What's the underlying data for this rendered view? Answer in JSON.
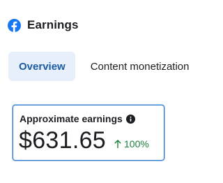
{
  "header": {
    "icon": "facebook-icon",
    "title": "Earnings"
  },
  "tabs": [
    {
      "label": "Overview",
      "active": true
    },
    {
      "label": "Content monetization",
      "active": false
    }
  ],
  "earnings_card": {
    "label": "Approximate earnings",
    "info_icon": "info-icon",
    "amount": "$631.65",
    "trend_icon": "arrow-up-icon",
    "trend_value": "100%"
  },
  "colors": {
    "facebook_blue": "#1877f2",
    "active_tab_bg": "#e7f0fa",
    "active_tab_text": "#1a5ba4",
    "card_border": "#2d7bd0",
    "trend_green": "#1a7f3c",
    "text": "#1c1e21"
  }
}
